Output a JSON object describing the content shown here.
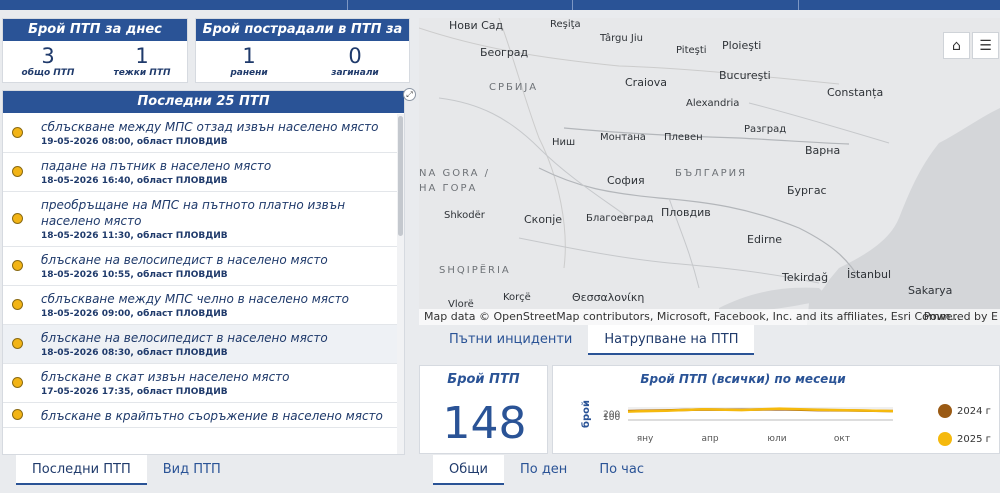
{
  "today_card": {
    "title": "Брой ПТП за днес",
    "total_value": "3",
    "total_label": "общо ПТП",
    "severe_value": "1",
    "severe_label": "тежки ПТП"
  },
  "injured_card": {
    "title": "Брой пострадали в ПТП за",
    "injured_value": "1",
    "injured_label": "ранени",
    "dead_value": "0",
    "dead_label": "загинали"
  },
  "list_panel": {
    "title": "Последни 25 ПТП",
    "items": [
      {
        "title": "сблъскване между МПС отзад извън населено място",
        "meta": "19-05-2026 08:00, област ПЛОВДИВ"
      },
      {
        "title": "падане на пътник в населено място",
        "meta": "18-05-2026 16:40, област ПЛОВДИВ"
      },
      {
        "title": "преобръщане на МПС на пътното платно извън населено място",
        "meta": "18-05-2026 11:30, област ПЛОВДИВ"
      },
      {
        "title": "блъскане на велосипедист в населено място",
        "meta": "18-05-2026 10:55, област ПЛОВДИВ"
      },
      {
        "title": "сблъскване между МПС челно в населено място",
        "meta": "18-05-2026 09:00, област ПЛОВДИВ"
      },
      {
        "title": "блъскане на велосипедист в населено място",
        "meta": "18-05-2026 08:30, област ПЛОВДИВ"
      },
      {
        "title": "блъскане в скат извън населено място",
        "meta": "17-05-2026 17:35, област ПЛОВДИВ"
      },
      {
        "title": "блъскане в крайпътно съоръжение в населено място",
        "meta": ""
      }
    ]
  },
  "left_tabs": [
    "Последни ПТП",
    "Вид ПТП"
  ],
  "map": {
    "labels": {
      "novi_sad": "Нови Сад",
      "resita": "Reşiţa",
      "targu_jiu": "Târgu Jiu",
      "pitesti": "Piteşti",
      "ploiesti": "Ploieşti",
      "belgrade": "Београд",
      "serbia": "СРБИЈА",
      "craiova": "Craiova",
      "bucharest": "Bucureşti",
      "alexandria": "Alexandria",
      "constanta": "Constanța",
      "montana": "Монтана",
      "pleven": "Плевен",
      "razgrad": "Разград",
      "nish": "Ниш",
      "varna": "Варна",
      "bulgaria": "БЪЛГАРИЯ",
      "sofia": "София",
      "montenegro1": "NA GORA /",
      "montenegro2": "НА ГОРА",
      "burgas": "Бургас",
      "shkoder": "Shkodër",
      "skopje": "Скопје",
      "blagoevgrad": "Благоевград",
      "plovdiv": "Пловдив",
      "edirne": "Edirne",
      "shqiperia": "SHQIPËRIA",
      "tekirdag": "Tekirdağ",
      "istanbul": "İstanbul",
      "sakarya": "Sakarya",
      "vlore": "Vlorë",
      "korce": "Korçë",
      "thessaloniki": "Θεσσαλονίκη"
    },
    "attribution": "Map data © OpenStreetMap contributors, Microsoft, Facebook, Inc. and its affiliates, Esri Comm...",
    "powered": "Powered by E"
  },
  "map_tabs": [
    "Пътни инциденти",
    "Натрупване на ПТП"
  ],
  "count_card": {
    "label": "Брой ПТП",
    "value": "148"
  },
  "chart_card": {
    "title": "Брой ПТП (всички) по месеци",
    "legend": [
      {
        "name": "2024 г",
        "color": "#9a5a14"
      },
      {
        "name": "2025 г",
        "color": "#f5b90d"
      }
    ]
  },
  "chart_data": {
    "type": "line",
    "title": "Брой ПТП (всички) по месеци",
    "ylabel": "брой",
    "categories": [
      "яну",
      "апр",
      "юли",
      "окт"
    ],
    "ylim": [
      0,
      200
    ],
    "yticks": [
      "200",
      "100"
    ],
    "series": [
      {
        "name": "2024 г",
        "values": [
          150,
          160,
          175,
          170,
          180,
          165,
          158,
          150
        ]
      },
      {
        "name": "2025 г",
        "values": [
          140,
          155,
          180,
          165,
          190,
          172,
          160,
          148
        ]
      }
    ]
  },
  "bottom_tabs": [
    "Общи",
    "По ден",
    "По час"
  ]
}
